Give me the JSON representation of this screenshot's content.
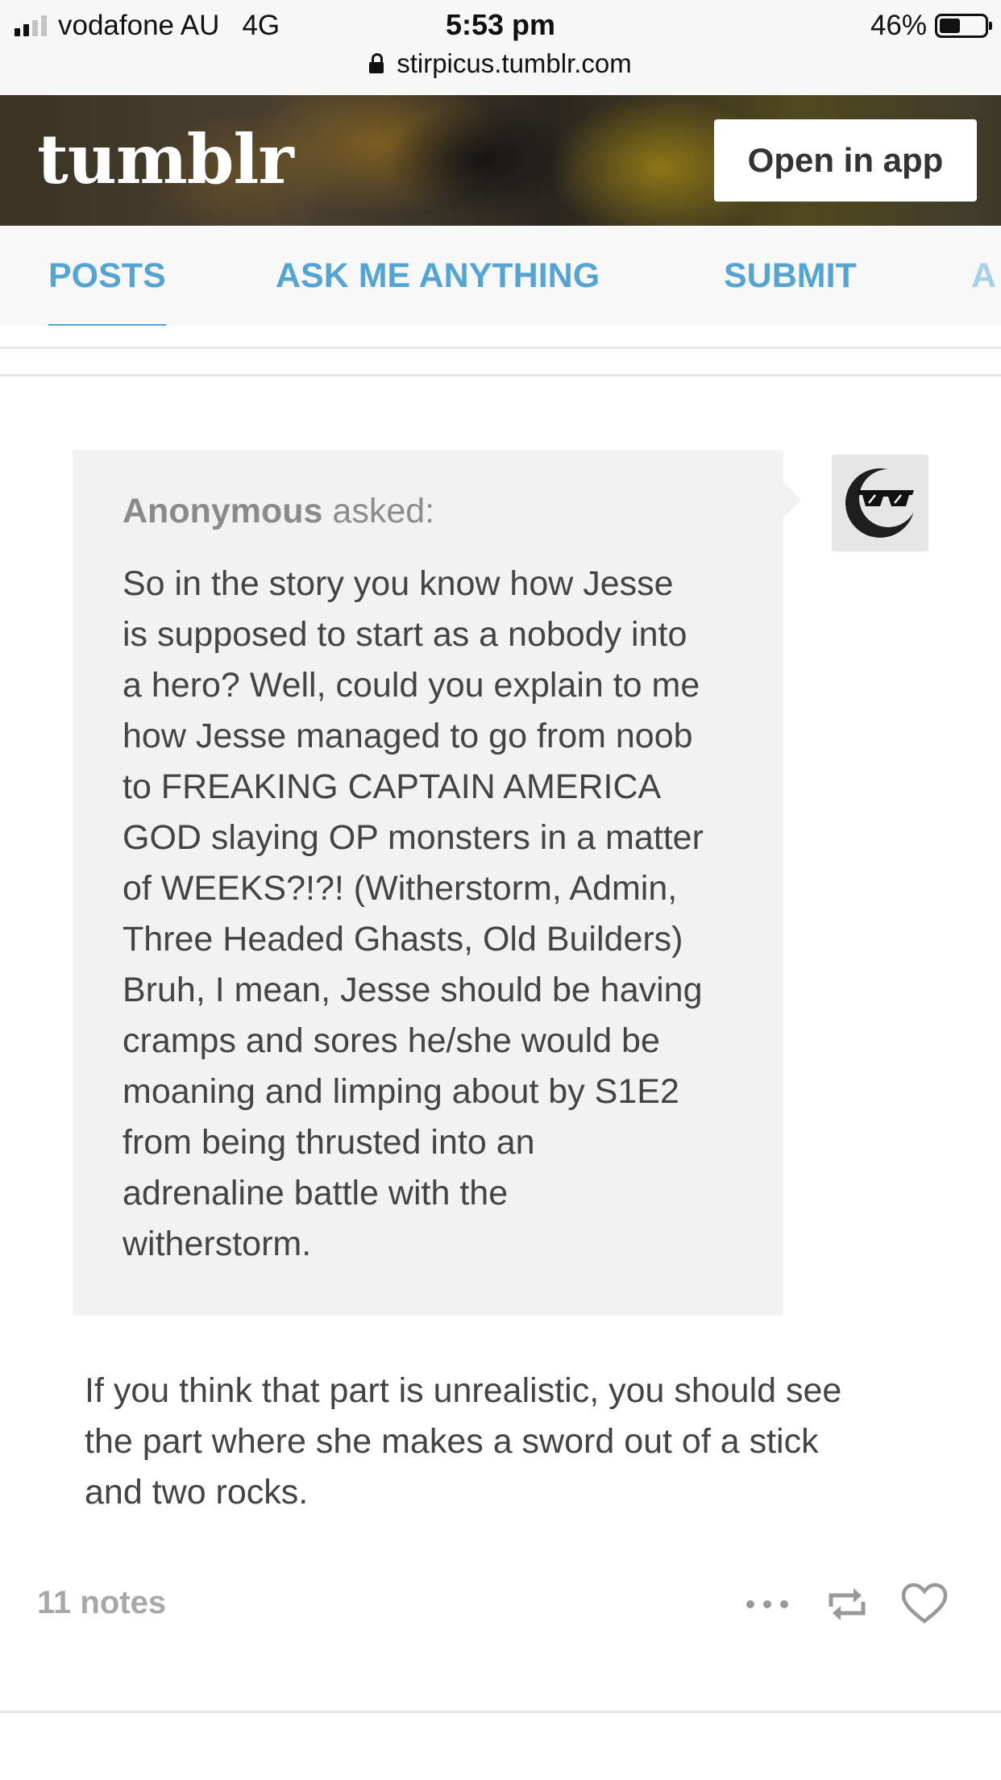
{
  "status_bar": {
    "carrier": "vodafone AU",
    "network": "4G",
    "time": "5:53 pm",
    "battery": "46%",
    "battery_level": 0.46,
    "url": "stirpicus.tumblr.com"
  },
  "header": {
    "logo": "tumblr",
    "open_in_app": "Open in app"
  },
  "tabs": [
    {
      "label": "POSTS",
      "active": true
    },
    {
      "label": "ASK ME ANYTHING",
      "active": false
    },
    {
      "label": "SUBMIT",
      "active": false
    },
    {
      "label": "A",
      "active": false
    }
  ],
  "post": {
    "asker_name": "Anonymous",
    "asker_suffix": "asked:",
    "question_lines": [
      "So in the story you know how Jesse",
      "is supposed to start as a nobody into",
      "a hero? Well, could you explain to me",
      "how Jesse managed to go from noob",
      "to FREAKING CAPTAIN AMERICA",
      "GOD slaying OP monsters in a matter",
      "of WEEKS?!?! (Witherstorm, Admin,",
      "Three Headed Ghasts, Old Builders)",
      "Bruh, I mean, Jesse should be having",
      "cramps and sores he/she would be",
      "moaning and limping about by S1E2",
      "from being thrusted into an",
      "adrenaline battle with the",
      "witherstorm."
    ],
    "answer_lines": [
      "If you think that part is unrealistic, you should see",
      "the part where she makes a sword out of a stick",
      "and two rocks."
    ],
    "notes": "11 notes"
  },
  "icons": {
    "more": "more-dots-icon",
    "reblog": "reblog-icon",
    "like": "heart-icon",
    "lock": "lock-icon",
    "avatar": "sunglasses-moon-avatar"
  },
  "colors": {
    "accent": "#56a4d2",
    "ask_bg": "#f2f2f2",
    "text": "#444444",
    "muted": "#a8a8a8"
  }
}
